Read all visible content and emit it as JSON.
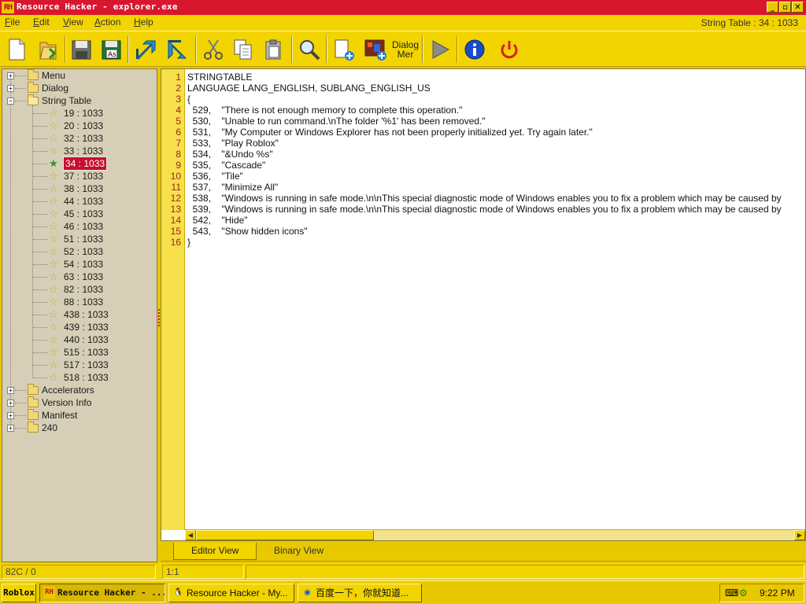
{
  "window": {
    "icon_text": "RH",
    "title": "Resource Hacker - explorer.exe",
    "buttons": [
      "_",
      "▫",
      "✕"
    ]
  },
  "menu": {
    "items": [
      "File",
      "Edit",
      "View",
      "Action",
      "Help"
    ],
    "right_title": "String Table : 34 : 1033"
  },
  "toolbar": {
    "buttons": [
      "new-file",
      "open-file",
      "save",
      "save-as",
      "compile",
      "compile-run",
      "cut",
      "copy",
      "paste",
      "find",
      "add-resource",
      "add-image",
      "dialog-merge",
      "run-script",
      "about",
      "exit"
    ],
    "dialog_label_line1": "Dialog",
    "dialog_label_line2": "Mer"
  },
  "tree": {
    "top_nodes": [
      {
        "label": "Menu",
        "expander": "+"
      },
      {
        "label": "Dialog",
        "expander": "+"
      },
      {
        "label": "String Table",
        "expander": "−"
      }
    ],
    "string_items": [
      "19 : 1033",
      "20 : 1033",
      "32 : 1033",
      "33 : 1033",
      "34 : 1033",
      "37 : 1033",
      "38 : 1033",
      "44 : 1033",
      "45 : 1033",
      "46 : 1033",
      "51 : 1033",
      "52 : 1033",
      "54 : 1033",
      "63 : 1033",
      "82 : 1033",
      "88 : 1033",
      "438 : 1033",
      "439 : 1033",
      "440 : 1033",
      "515 : 1033",
      "517 : 1033",
      "518 : 1033"
    ],
    "selected_item": "34 : 1033",
    "bottom_nodes": [
      {
        "label": "Accelerators",
        "expander": "+"
      },
      {
        "label": "Version Info",
        "expander": "+"
      },
      {
        "label": "Manifest",
        "expander": "+"
      },
      {
        "label": "240",
        "expander": "+"
      }
    ]
  },
  "editor": {
    "lines": [
      "STRINGTABLE",
      "LANGUAGE LANG_ENGLISH, SUBLANG_ENGLISH_US",
      "{",
      "  529,    \"There is not enough memory to complete this operation.\"",
      "  530,    \"Unable to run command.\\nThe folder '%1' has been removed.\"",
      "  531,    \"My Computer or Windows Explorer has not been properly initialized yet. Try again later.\"",
      "  533,    \"Play Roblox\"",
      "  534,    \"&Undo %s\"",
      "  535,    \"Cascade\"",
      "  536,    \"Tile\"",
      "  537,    \"Minimize All\"",
      "  538,    \"Windows is running in safe mode.\\n\\nThis special diagnostic mode of Windows enables you to fix a problem which may be caused by",
      "  539,    \"Windows is running in safe mode.\\n\\nThis special diagnostic mode of Windows enables you to fix a problem which may be caused by",
      "  542,    \"Hide\"",
      "  543,    \"Show hidden icons\"",
      "}"
    ]
  },
  "tabs": [
    "Editor View",
    "Binary View"
  ],
  "status": {
    "offset": "82C / 0",
    "position": "1:1"
  },
  "taskbar": {
    "start": "Roblox",
    "tasks": [
      {
        "label": "Resource Hacker - ...",
        "active": true
      },
      {
        "label": "Resource Hacker - My...",
        "active": false
      },
      {
        "label": "百度一下，你就知道...",
        "active": false
      }
    ],
    "clock": "9:22 PM"
  },
  "colors": {
    "titlebar": "#d8172e",
    "chrome": "#f2d400",
    "tree_bg": "#d6ceb6",
    "selection": "#c8102e",
    "gutter": "#f6e04c"
  }
}
